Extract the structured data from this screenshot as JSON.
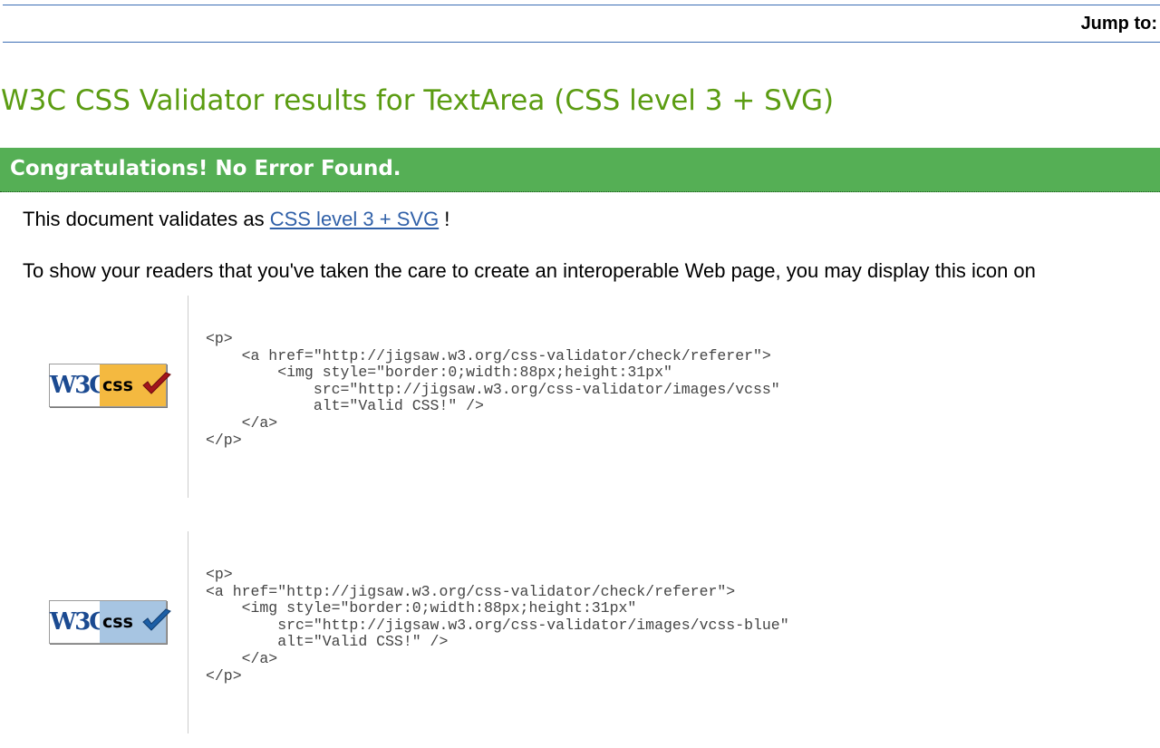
{
  "jump_bar": {
    "label": "Jump to:"
  },
  "page_title": "W3C CSS Validator results for TextArea (CSS level 3 + SVG)",
  "congrats": "Congratulations! No Error Found.",
  "validates": {
    "prefix": "This document validates as",
    "link": "CSS level 3 + SVG",
    "suffix": " !"
  },
  "readers_text": "To show your readers that you've taken the care to create an interoperable Web page, you may display this icon on",
  "badges": [
    {
      "w3c": "W3C",
      "css": "css",
      "icon": "gold-checkmark",
      "accent": "#f4b940",
      "code": "<p>\n    <a href=\"http://jigsaw.w3.org/css-validator/check/referer\">\n        <img style=\"border:0;width:88px;height:31px\"\n            src=\"http://jigsaw.w3.org/css-validator/images/vcss\"\n            alt=\"Valid CSS!\" />\n    </a>\n</p>"
    },
    {
      "w3c": "W3C",
      "css": "css",
      "icon": "blue-checkmark",
      "accent": "#a7c5e2",
      "code": "<p>\n<a href=\"http://jigsaw.w3.org/css-validator/check/referer\">\n    <img style=\"border:0;width:88px;height:31px\"\n        src=\"http://jigsaw.w3.org/css-validator/images/vcss-blue\"\n        alt=\"Valid CSS!\" />\n    </a>\n</p>"
    }
  ],
  "colors": {
    "title_green": "#5b9c12",
    "banner_green": "#55af55",
    "link_blue": "#3060a8",
    "rule_blue": "#3c6eb4"
  }
}
